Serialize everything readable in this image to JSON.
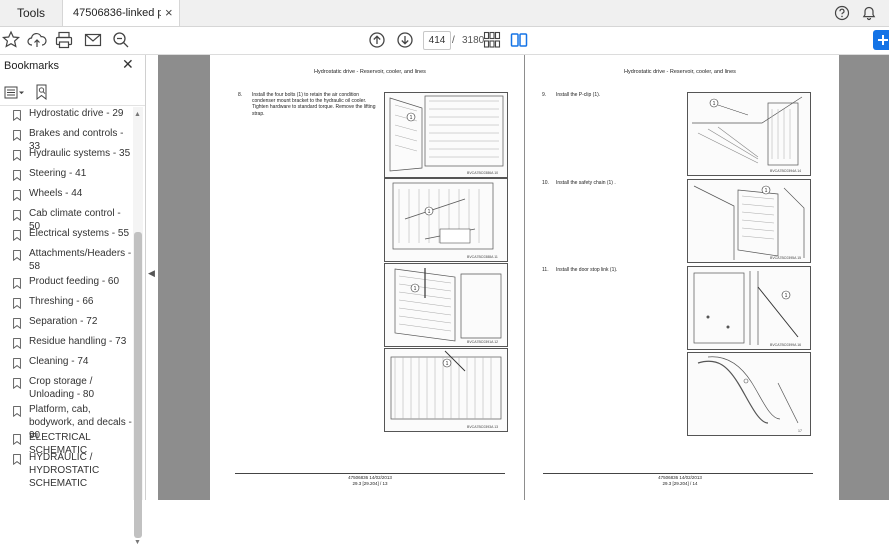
{
  "tabs": {
    "tools_label": "Tools",
    "doc_label": "47506836-linked pd...",
    "close_glyph": "×"
  },
  "toolbar": {
    "icons": [
      "star-icon",
      "cloud-upload-icon",
      "print-icon",
      "email-icon",
      "zoom-icon",
      "prev-page-icon",
      "next-page-icon",
      "page-thumbnails-icon",
      "two-page-view-icon",
      "help-icon",
      "bell-icon",
      "account-icon",
      "share-icon"
    ],
    "page_current": "414",
    "page_sep": "/",
    "page_total": "3180"
  },
  "sidebar": {
    "title": "Bookmarks",
    "close_glyph": "✕",
    "items": [
      {
        "label": "Hydrostatic drive - 29"
      },
      {
        "label": "Brakes and controls - 33"
      },
      {
        "label": "Hydraulic systems - 35"
      },
      {
        "label": "Steering - 41"
      },
      {
        "label": "Wheels - 44"
      },
      {
        "label": "Cab climate control - 50"
      },
      {
        "label": "Electrical systems - 55"
      },
      {
        "label": "Attachments/Headers - 58"
      },
      {
        "label": "Product feeding - 60"
      },
      {
        "label": "Threshing - 66"
      },
      {
        "label": "Separation - 72"
      },
      {
        "label": "Residue handling - 73"
      },
      {
        "label": "Cleaning - 74"
      },
      {
        "label": "Crop storage / Unloading - 80"
      },
      {
        "label": "Platform, cab, bodywork, and decals - 90"
      },
      {
        "label": "ELECTRICAL SCHEMATIC"
      },
      {
        "label": "HYDRAULIC / HYDROSTATIC SCHEMATIC"
      }
    ]
  },
  "document": {
    "left_page": {
      "header": "Hydrostatic drive - Reservoir, cooler, and lines",
      "step_number": "8.",
      "step_text": "Install the four bolts (1) to retain the air condition condenser mount bracket to the hydraulic oil cooler. Tighten hardware to standard torque. Remove the lifting strap.",
      "footer_line1": "47506836 14/02/2013",
      "footer_line2": "29.3 [29.204] / 13",
      "figure_captions": [
        "BVCA7BC0386A 10",
        "BVCA7BC0388A 11",
        "BVCA7BC0391A 12",
        "BVCA7BC0393A 13"
      ]
    },
    "right_page": {
      "header": "Hydrostatic drive - Reservoir, cooler, and lines",
      "steps": [
        {
          "num": "9.",
          "text": "Install the P-clip (1)."
        },
        {
          "num": "10.",
          "text": "Install the safety chain (1) ."
        },
        {
          "num": "11.",
          "text": "Install the door stop link (1)."
        }
      ],
      "footer_line1": "47506836 14/02/2013",
      "footer_line2": "29.3 [29.204] / 14",
      "figure_captions": [
        "BVCA7BC0394A 14",
        "BVCA7BC0395A 15",
        "BVCA7BC0399A 16",
        "17"
      ]
    },
    "callout_label": "1"
  },
  "colors": {
    "accent": "#1473e6",
    "doc_background": "#8d8d8d"
  }
}
